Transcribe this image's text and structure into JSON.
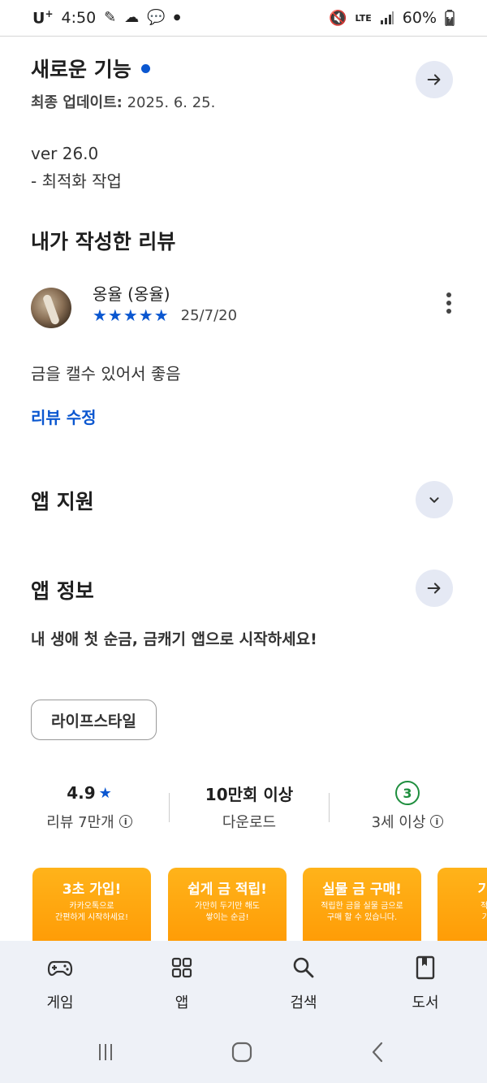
{
  "status_bar": {
    "carrier": "U",
    "carrier_plus": "+",
    "time": "4:50",
    "network": "LTE",
    "battery": "60%"
  },
  "whats_new": {
    "title": "새로운 기능",
    "date_label": "최종 업데이트:",
    "date_value": "2025. 6. 25.",
    "version": "ver 26.0",
    "note": "- 최적화 작업"
  },
  "my_review": {
    "title": "내가 작성한 리뷰",
    "reviewer_name": "옹율 (옹율)",
    "stars": "★★★★★",
    "rating": 5,
    "date": "25/7/20",
    "text": "금을 캘수 있어서 좋음",
    "edit_label": "리뷰 수정"
  },
  "app_support": {
    "title": "앱 지원"
  },
  "app_info": {
    "title": "앱 정보",
    "tagline": "내 생애 첫 순금, 금캐기 앱으로 시작하세요!",
    "category_chip": "라이프스타일"
  },
  "stats": {
    "rating_value": "4.9",
    "rating_star": "★",
    "reviews_label": "리뷰 7만개",
    "downloads_number": "10만회 이상",
    "downloads_label": "다운로드",
    "age_number": "3",
    "age_label": "3세 이상"
  },
  "screenshots": [
    {
      "title": "3초 가입!",
      "line1": "카카오톡으로",
      "line2": "간편하게 시작하세요!"
    },
    {
      "title": "쉽게 금 적립!",
      "line1": "가만히 두기만 해도",
      "line2": "쌓이는 순금!"
    },
    {
      "title": "실물 금 구매!",
      "line1": "적립한 금을 실물 금으로",
      "line2": "구매 할 수 있습니다."
    },
    {
      "title": "기프티",
      "line1": "적립한 금",
      "line2": "기프티콘"
    }
  ],
  "bottom_nav": {
    "games": "게임",
    "apps": "앱",
    "search": "검색",
    "books": "도서"
  },
  "colors": {
    "accent_blue": "#0b57d0",
    "age_green": "#1e8e3e",
    "screenshot_orange": "#ff9500",
    "nav_background": "#eef1f7"
  }
}
